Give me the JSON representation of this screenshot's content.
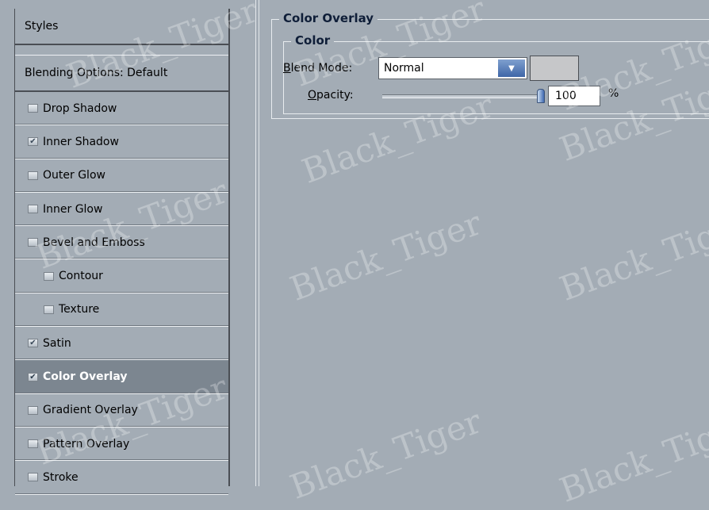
{
  "sidebar": {
    "header": "Styles",
    "blending_options": "Blending Options: Default",
    "items": [
      {
        "label": "Drop Shadow",
        "checked": false
      },
      {
        "label": "Inner Shadow",
        "checked": true
      },
      {
        "label": "Outer Glow",
        "checked": false
      },
      {
        "label": "Inner Glow",
        "checked": false
      },
      {
        "label": "Bevel and Emboss",
        "checked": false
      },
      {
        "label": "Contour",
        "checked": false,
        "sub": true
      },
      {
        "label": "Texture",
        "checked": false,
        "sub": true
      },
      {
        "label": "Satin",
        "checked": true
      },
      {
        "label": "Color Overlay",
        "checked": true,
        "selected": true
      },
      {
        "label": "Gradient Overlay",
        "checked": false
      },
      {
        "label": "Pattern Overlay",
        "checked": false
      },
      {
        "label": "Stroke",
        "checked": false
      }
    ]
  },
  "panel": {
    "title": "Color Overlay",
    "group_title": "Color",
    "blend_mode_label": "Blend Mode:",
    "blend_mode_value": "Normal",
    "overlay_color": "#c6c7c9",
    "opacity_label": "Opacity:",
    "opacity_value": "100",
    "opacity_fraction": 1.0,
    "percent": "%"
  },
  "watermark": "Black_Tiger",
  "colors": {
    "background": "#a3acb5",
    "selected_item": "#7c8690",
    "accent": "#3f66a7"
  }
}
